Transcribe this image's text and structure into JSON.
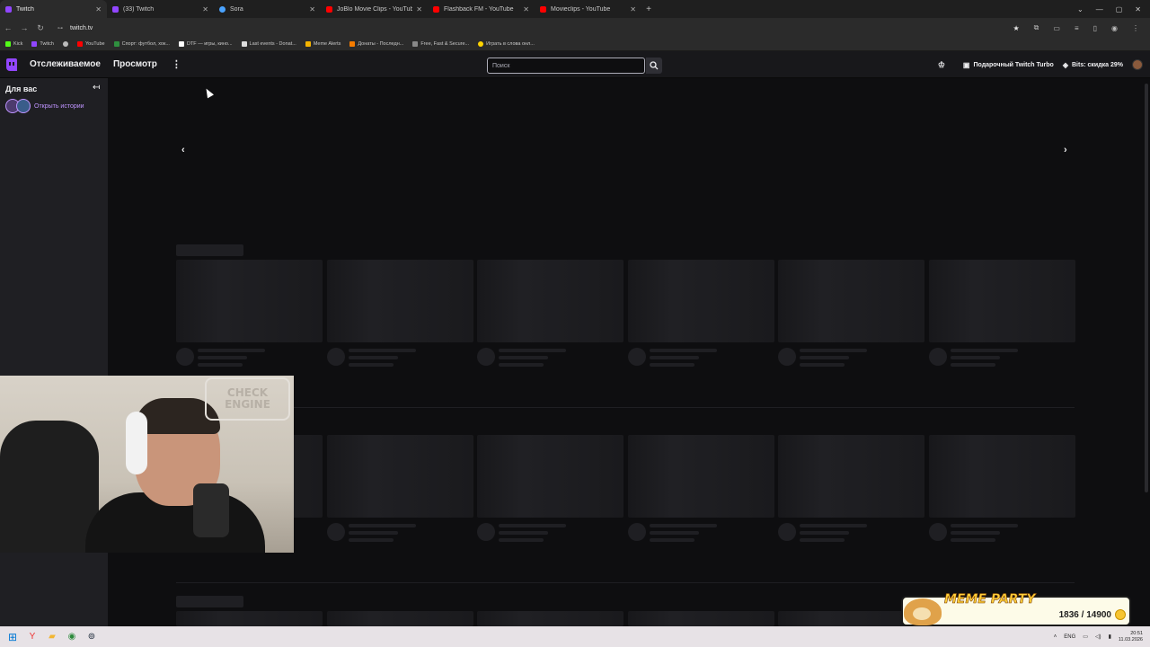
{
  "browser": {
    "tabs": [
      {
        "title": "Twitch",
        "color": "#9146ff",
        "active": true
      },
      {
        "title": "(33) Twitch",
        "color": "#9146ff",
        "active": false
      },
      {
        "title": "Sora",
        "color": "#4aa3ff",
        "active": false
      },
      {
        "title": "JoBlo Movie Clips - YouTube",
        "color": "#ff0000",
        "active": false
      },
      {
        "title": "Flashback FM - YouTube",
        "color": "#ff0000",
        "active": false
      },
      {
        "title": "Movieclips - YouTube",
        "color": "#ff0000",
        "active": false
      }
    ],
    "url": "twitch.tv",
    "bookmarks": [
      {
        "label": "Kick",
        "color": "#53fc18"
      },
      {
        "label": "Twitch",
        "color": "#9146ff"
      },
      {
        "label": "",
        "color": "#bbbbbb"
      },
      {
        "label": "YouTube",
        "color": "#ff0000"
      },
      {
        "label": "Спорт: футбол, хок...",
        "color": "#2f8f3f"
      },
      {
        "label": "DTF — игры, кино...",
        "color": "#ffffff"
      },
      {
        "label": "Last events - Donat...",
        "color": "#dddddd"
      },
      {
        "label": "Meme Alerts",
        "color": "#f5b400"
      },
      {
        "label": "Донаты - Последн...",
        "color": "#f57c00"
      },
      {
        "label": "Free, Fast & Secure...",
        "color": "#888888"
      },
      {
        "label": "Играть в слова онл...",
        "color": "#ffd400"
      }
    ]
  },
  "twitch": {
    "nav": {
      "following": "Отслеживаемое",
      "browse": "Просмотр",
      "more": "⋮",
      "search_placeholder": "Поиск",
      "gift_turbo": "Подарочный Twitch Turbo",
      "bits": "Bits: скидка 29%"
    },
    "sidebar": {
      "heading": "Для вас",
      "collapse": "↤",
      "stories": "Открыть истории"
    },
    "carousel": {
      "prev": "‹",
      "next": "›"
    }
  },
  "overlay": {
    "webcam_sign": [
      "CHECK",
      "ENGINE"
    ],
    "meme_party": {
      "title": "MEME PARTY",
      "count": "1836 / 14900"
    }
  },
  "taskbar": {
    "lang": "ENG",
    "time": "20:51",
    "date": "11.03.2026"
  },
  "colors": {
    "brand": "#9146ff",
    "bg": "#0e0e10",
    "sidebar": "#1f1f23"
  }
}
